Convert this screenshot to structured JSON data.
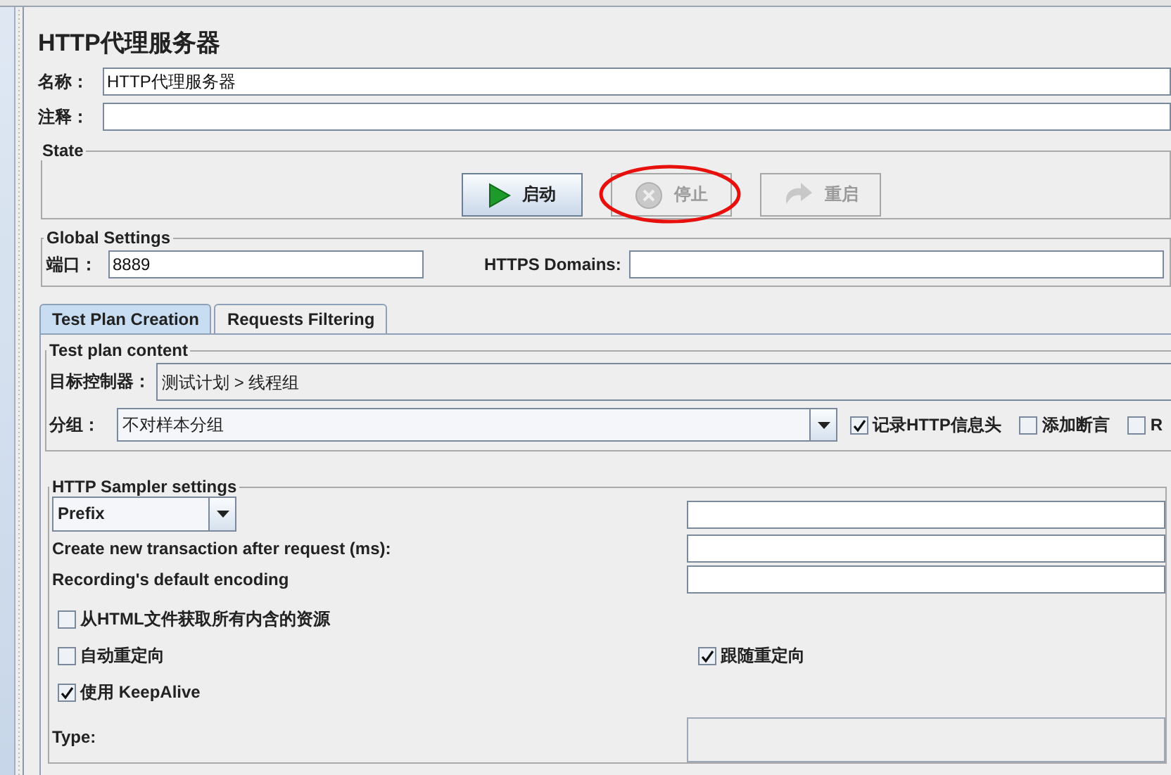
{
  "title": "HTTP代理服务器",
  "name_field": {
    "label": "名称：",
    "value": "HTTP代理服务器"
  },
  "comment_field": {
    "label": "注释："
  },
  "state": {
    "title": "State",
    "buttons": [
      {
        "label": "启动",
        "kind": "start",
        "disabled": false,
        "circled": false
      },
      {
        "label": "停止",
        "kind": "stop",
        "disabled": true,
        "circled": true
      },
      {
        "label": "重启",
        "kind": "restart",
        "disabled": true,
        "circled": false
      }
    ]
  },
  "global_settings": {
    "title": "Global Settings",
    "port": {
      "label": "端口：",
      "value": "8889"
    },
    "https_domains": {
      "label": "HTTPS Domains:"
    }
  },
  "tabs": [
    {
      "label": "Test Plan Creation",
      "selected": true
    },
    {
      "label": "Requests Filtering",
      "selected": false
    }
  ],
  "test_plan_content": {
    "title": "Test plan content",
    "target_controller": {
      "label": "目标控制器：",
      "value": "测试计划 > 线程组"
    },
    "grouping": {
      "label": "分组：",
      "value": "不对样本分组"
    },
    "options": [
      {
        "label": "记录HTTP信息头",
        "checked": true
      },
      {
        "label": "添加断言",
        "checked": false
      },
      {
        "label": "R",
        "checked": false
      }
    ]
  },
  "sampler_settings": {
    "title": "HTTP Sampler settings",
    "prefix": {
      "value": "Prefix"
    },
    "fields": [
      {
        "label": "Create new transaction after request (ms):"
      },
      {
        "label": "Recording's default encoding"
      }
    ],
    "checkbox_rows": [
      {
        "items": [
          {
            "label": "从HTML文件获取所有内含的资源",
            "checked": false
          }
        ]
      },
      {
        "items": [
          {
            "label": "自动重定向",
            "checked": false
          },
          {
            "label": "跟随重定向",
            "checked": true
          }
        ]
      },
      {
        "items": [
          {
            "label": "使用 KeepAlive",
            "checked": true
          }
        ]
      }
    ],
    "type": {
      "label": "Type:"
    }
  }
}
